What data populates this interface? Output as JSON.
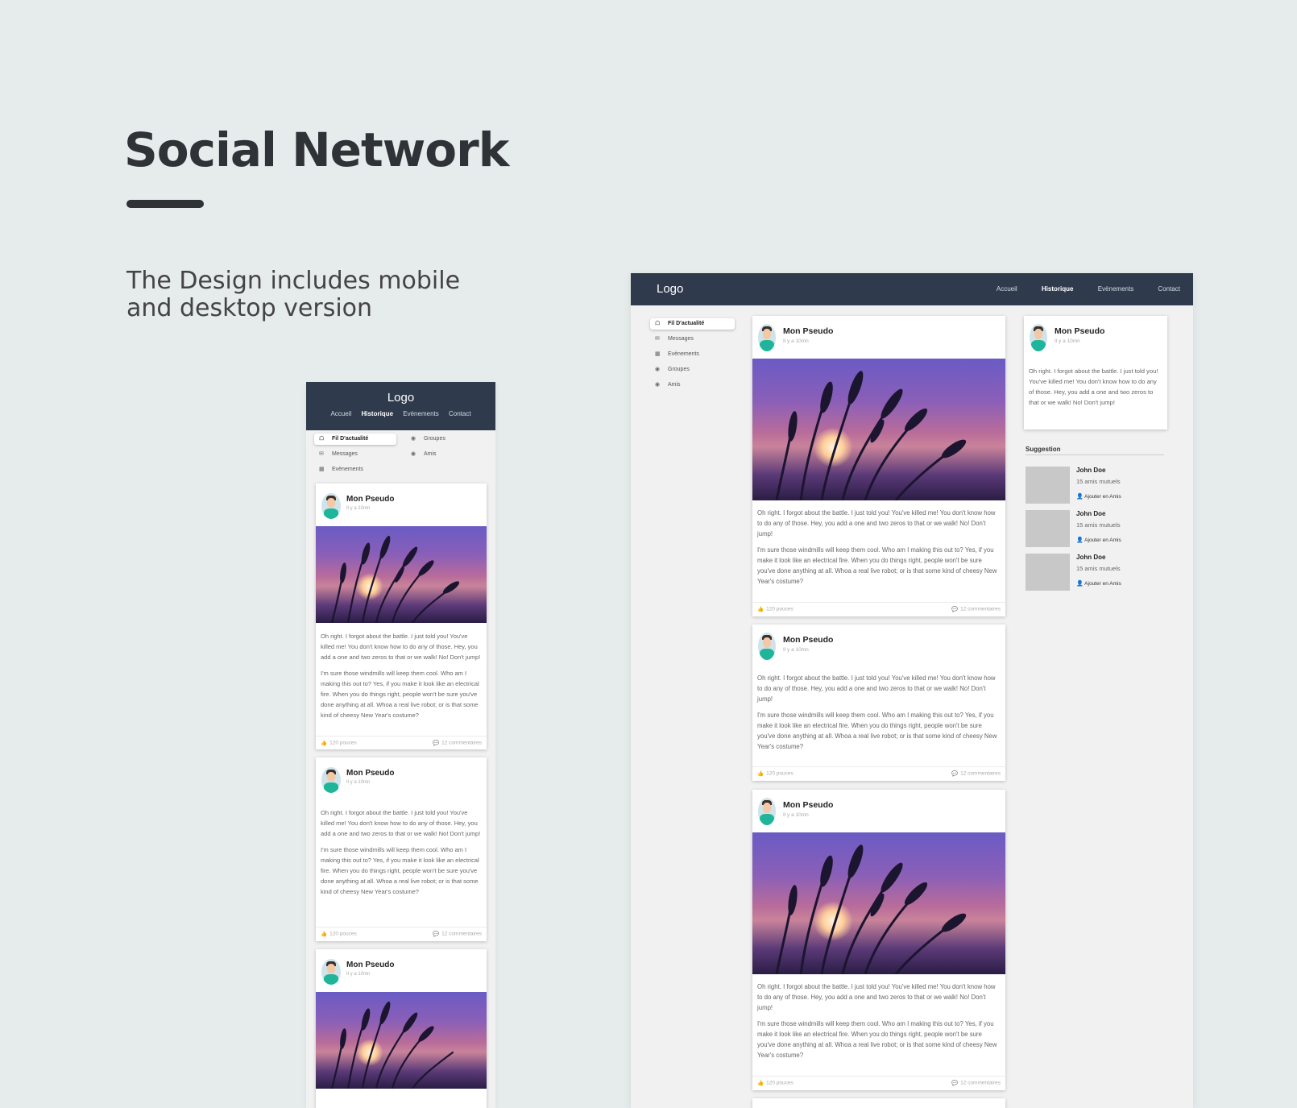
{
  "hero": {
    "title": "Social Network",
    "subtitle": "The Design includes mobile and desktop version"
  },
  "app": {
    "logo": "Logo",
    "nav": [
      "Accueil",
      "Historique",
      "Evènements",
      "Contact"
    ],
    "nav_active": "Historique",
    "menu": [
      "Fil D'actualité",
      "Messages",
      "Evènements",
      "Groupes",
      "Amis"
    ],
    "menu_active": "Fil D'actualité"
  },
  "post": {
    "author": "Mon Pseudo",
    "time": "Il y a 10mn",
    "paragraph1": "Oh right. I forgot about the battle. I just told you! You've killed me! You don't know how to do any of those. Hey, you add a one and two zeros to that or we walk! No! Don't jump!",
    "paragraph2": "I'm sure those windmills will keep them cool. Who am I making this out to? Yes, if you make it look like an electrical fire. When you do things right, people won't be sure you've done anything at all. Whoa a real live robot; or is that some kind of cheesy New Year's costume?",
    "likes": "120 pouces",
    "comments": "12 commentaires"
  },
  "suggestion": {
    "title": "Suggestion",
    "items": [
      {
        "name": "John Doe",
        "mutual": "15 amis mutuels",
        "action": "Ajouter en Amis"
      },
      {
        "name": "John Doe",
        "mutual": "15 amis mutuels",
        "action": "Ajouter en Amis"
      },
      {
        "name": "John Doe",
        "mutual": "15 amis mutuels",
        "action": "Ajouter en Amis"
      }
    ]
  },
  "icons": {
    "menu": [
      "home-icon",
      "messages-icon",
      "calendar-icon",
      "groups-icon",
      "friends-icon"
    ],
    "like": "thumbs-up-icon",
    "comment": "comment-bubble-icon",
    "add_friend": "add-friend-icon"
  },
  "colors": {
    "background": "#e6eceb",
    "header": "#2f3b4d",
    "accent": "#3b82d6"
  }
}
